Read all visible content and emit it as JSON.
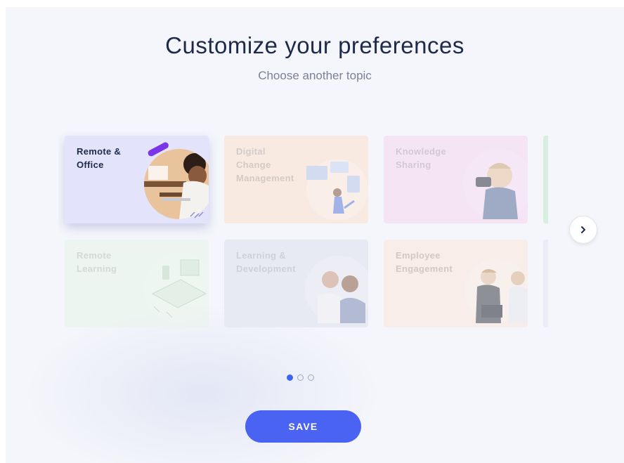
{
  "header": {
    "title": "Customize your preferences",
    "subtitle": "Choose another topic"
  },
  "topics": [
    {
      "label_line1": "Remote &",
      "label_line2": "Office",
      "selected": true,
      "bg": "#e3e4fb",
      "text_color": "#1d2a4a"
    },
    {
      "label_line1": "Digital Change",
      "label_line2": "Management",
      "selected": false,
      "bg": "#fbdfcd",
      "text_color": "#b9a9a0"
    },
    {
      "label_line1": "Knowledge",
      "label_line2": "Sharing",
      "selected": false,
      "bg": "#f5d7f0",
      "text_color": "#b8a3b8"
    },
    {
      "label_line1": "Remote",
      "label_line2": "Learning",
      "selected": false,
      "bg": "#e8f5ea",
      "text_color": "#b8c2bb"
    },
    {
      "label_line1": "Learning &",
      "label_line2": "Development",
      "selected": false,
      "bg": "#dfe2ee",
      "text_color": "#aeb2c4"
    },
    {
      "label_line1": "Employee",
      "label_line2": "Engagement",
      "selected": false,
      "bg": "#fbe6d9",
      "text_color": "#b9a597"
    }
  ],
  "next_button": {
    "icon": "chevron-right-icon"
  },
  "pagination": {
    "pages": 3,
    "current": 1
  },
  "save_button": {
    "label": "SAVE"
  },
  "colors": {
    "accent": "#4a63f3",
    "title": "#1d2a4a",
    "background": "#f5f6fb"
  }
}
